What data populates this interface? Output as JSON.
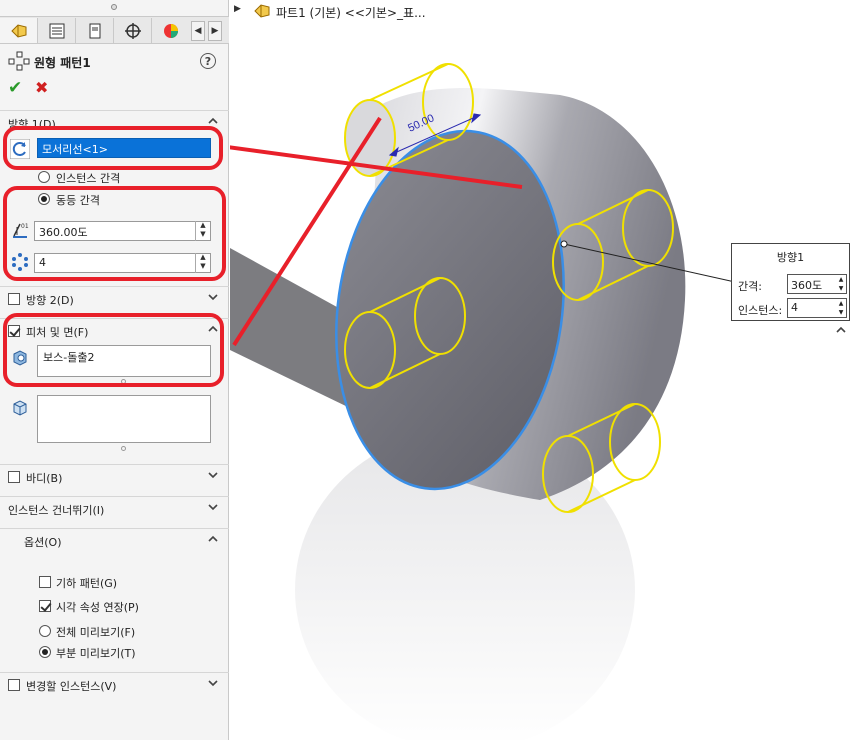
{
  "panel": {
    "title": "원형 패턴1",
    "help_label": "?",
    "ok_label": "✔",
    "cancel_label": "✖",
    "direction1": {
      "label": "방향 1(D)",
      "axis_value": "모서리선<1>",
      "spacing_instance": "인스턴스 간격",
      "spacing_equal": "동등 간격",
      "angle_value": "360.00도",
      "count_value": "4"
    },
    "direction2": {
      "label": "방향 2(D)"
    },
    "features": {
      "label": "피처 및 면(F)",
      "items": [
        "보스-돌출2"
      ]
    },
    "bodies": {
      "label": "바디(B)"
    },
    "skip": {
      "label": "인스턴스 건너뛰기(I)"
    },
    "options": {
      "label": "옵션(O)",
      "geometry_pattern": "기하 패턴(G)",
      "propagate_visual": "시각 속성 연장(P)",
      "full_preview": "전체 미리보기(F)",
      "partial_preview": "부분 미리보기(T)"
    },
    "vary": {
      "label": "변경할 인스턴스(V)"
    }
  },
  "viewport": {
    "tree_label": "파트1 (기본) <<기본>_표...",
    "dimension": "50.00",
    "callout": {
      "title": "방향1",
      "spacing_label": "간격:",
      "spacing_value": "360도",
      "instances_label": "인스턴스:",
      "instances_value": "4"
    }
  },
  "colors": {
    "highlight": "#e8202a",
    "selection": "#0a72d8",
    "preview": "#f0e000",
    "edge_select": "#3a8ee6"
  }
}
